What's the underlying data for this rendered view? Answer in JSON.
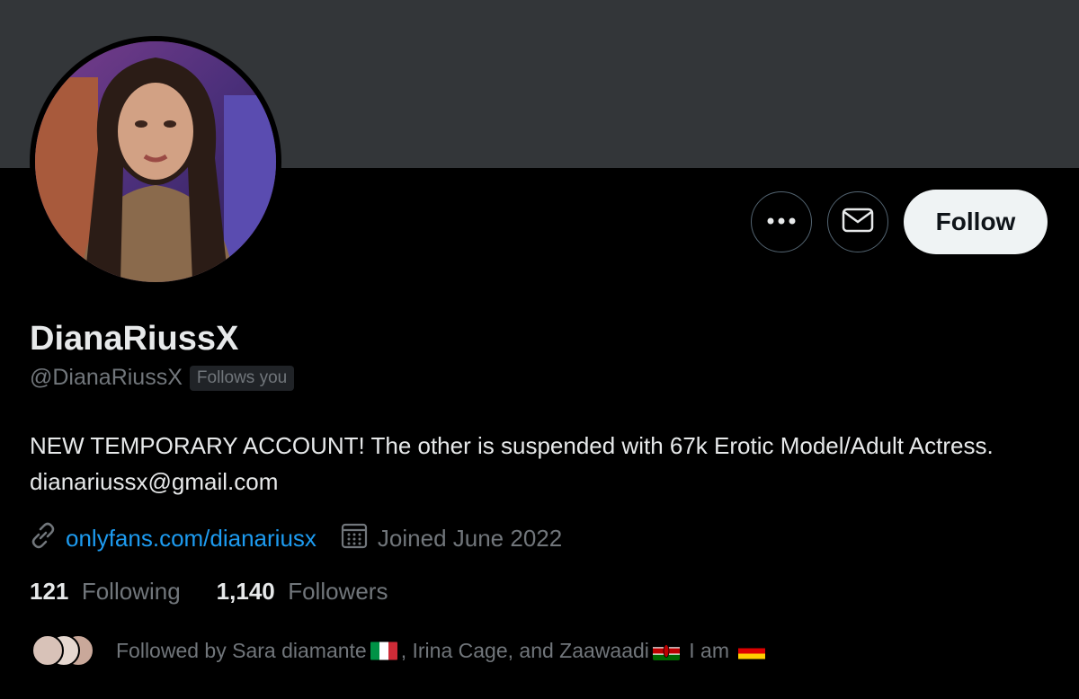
{
  "profile": {
    "display_name": "DianaRiussX",
    "handle": "@DianaRiussX",
    "follows_you_badge": "Follows you",
    "bio": "NEW TEMPORARY ACCOUNT! The other is suspended with 67k Erotic Model/Adult Actress. dianariussx@gmail.com",
    "website": "onlyfans.com/dianariusx",
    "joined": "Joined June 2022"
  },
  "actions": {
    "more_icon": "ellipsis-icon",
    "message_icon": "envelope-icon",
    "follow_label": "Follow"
  },
  "stats": {
    "following_count": "121",
    "following_label": "Following",
    "followers_count": "1,140",
    "followers_label": "Followers"
  },
  "followed_by": {
    "prefix": "Followed by Sara diamante",
    "middle": ", Irina Cage, and Zaawaadi",
    "suffix": "I am",
    "flags": [
      "italy-flag",
      "kenya-flag",
      "germany-flag"
    ]
  },
  "colors": {
    "banner": "#333639",
    "link": "#1d9bf0",
    "muted": "#71767b",
    "follow_button_bg": "#eff3f4"
  }
}
